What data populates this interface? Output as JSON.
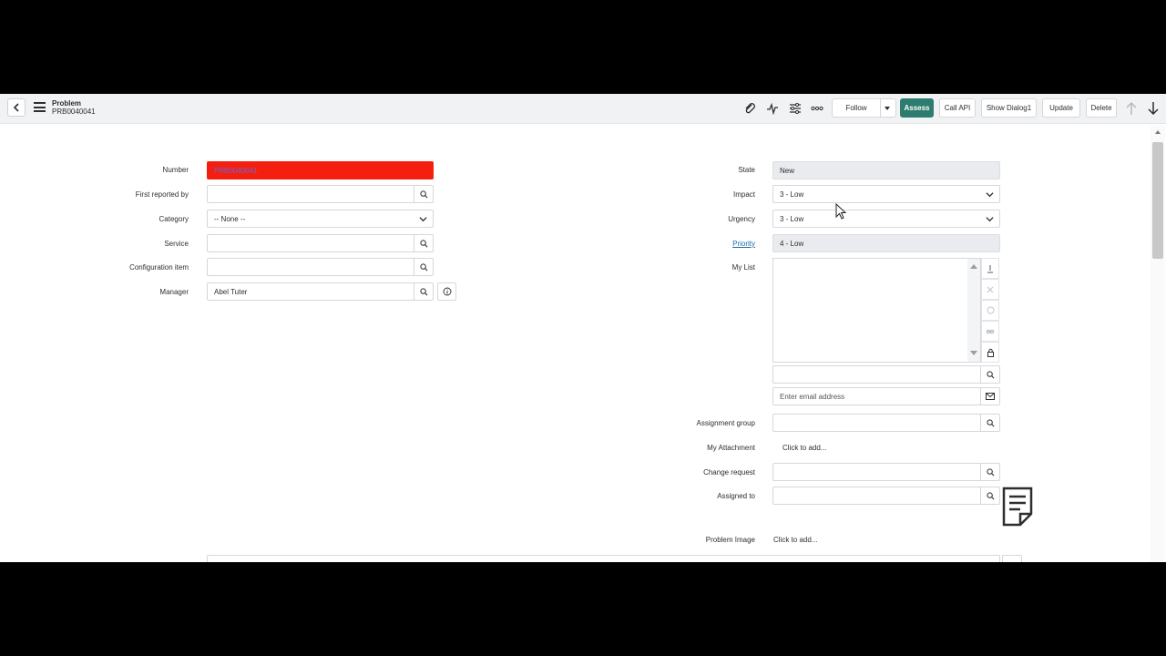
{
  "header": {
    "title": "Problem",
    "subtitle": "PRB0040041",
    "buttons": {
      "follow": "Follow",
      "assess": "Assess",
      "call_api": "Call API",
      "show_dialog": "Show Dialog1",
      "update": "Update",
      "delete": "Delete"
    }
  },
  "form": {
    "number_label": "Number",
    "number_value": "PRB0040041",
    "first_reported_label": "First reported by",
    "category_label": "Category",
    "category_value": "-- None --",
    "service_label": "Service",
    "ci_label": "Configuration item",
    "manager_label": "Manager",
    "manager_value": "Abel Tuter",
    "state_label": "State",
    "state_value": "New",
    "impact_label": "Impact",
    "impact_value": "3 - Low",
    "urgency_label": "Urgency",
    "urgency_value": "3 - Low",
    "priority_label": "Priority",
    "priority_value": "4 - Low",
    "my_list_label": "My List",
    "email_placeholder": "Enter email address",
    "assignment_group_label": "Assignment group",
    "my_attachment_label": "My Attachment",
    "my_attachment_action": "Click to add...",
    "change_request_label": "Change request",
    "assigned_to_label": "Assigned to",
    "problem_image_label": "Problem Image",
    "problem_image_action": "Click to add..."
  },
  "colors": {
    "accent": "#2e7c6f",
    "number_highlight": "#f51f0f",
    "link": "#1f6aa8"
  }
}
